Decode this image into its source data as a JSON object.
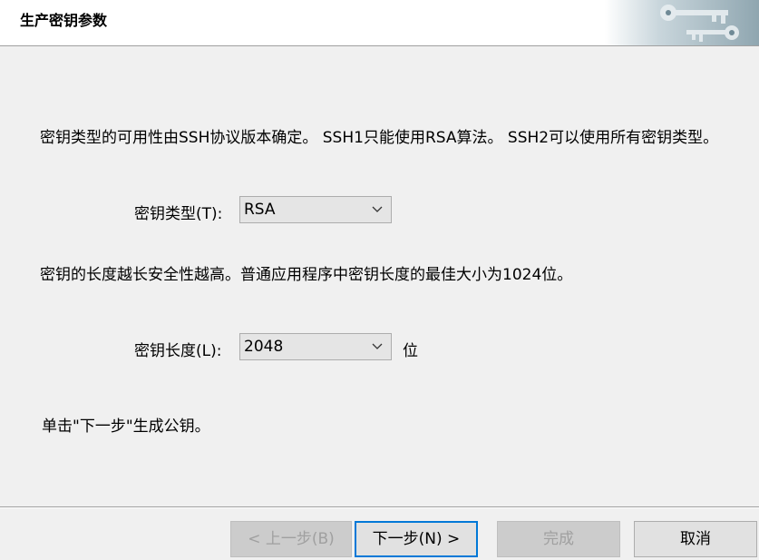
{
  "header": {
    "title": "生产密钥参数"
  },
  "content": {
    "type_description": "密钥类型的可用性由SSH协议版本确定。 SSH1只能使用RSA算法。 SSH2可以使用所有密钥类型。",
    "type_label": "密钥类型(T):",
    "type_value": "RSA",
    "length_description": "密钥的长度越长安全性越高。普通应用程序中密钥长度的最佳大小为1024位。",
    "length_label": "密钥长度(L):",
    "length_value": "2048",
    "length_unit": "位",
    "instruction": "单击\"下一步\"生成公钥。"
  },
  "buttons": {
    "back": "< 上一步(B)",
    "next": "下一步(N) >",
    "finish": "完成",
    "cancel": "取消"
  },
  "colors": {
    "background": "#f0f0f0",
    "focus_border": "#0078d7",
    "disabled_text": "#a0a0a0"
  }
}
